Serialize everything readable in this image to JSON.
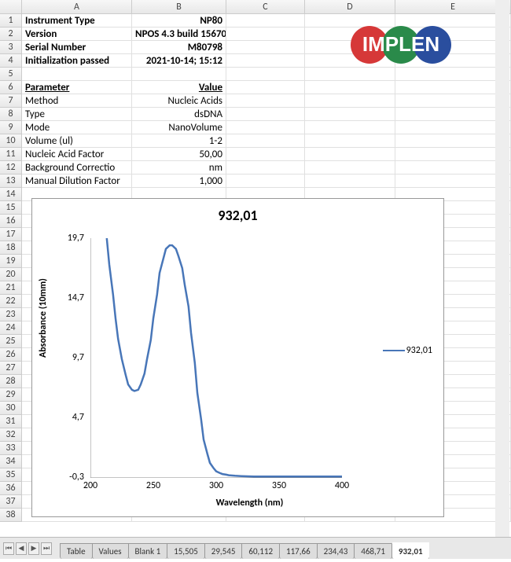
{
  "columns": [
    "A",
    "B",
    "C",
    "D",
    "E"
  ],
  "rows_count": 38,
  "cells": {
    "1": {
      "A": "Instrument Type",
      "B": "NP80",
      "bold": true
    },
    "2": {
      "A": "Version",
      "B": "NPOS 4.3 build 15670",
      "bold": true
    },
    "3": {
      "A": "Serial Number",
      "B": "M80798",
      "bold": true
    },
    "4": {
      "A": "Initialization passed",
      "B": "2021-10-14;  15:12",
      "bold": true
    },
    "5": {
      "A": "",
      "B": ""
    },
    "6": {
      "A": "Parameter",
      "B": "Value",
      "bold": true,
      "underline": true
    },
    "7": {
      "A": "Method",
      "B": "Nucleic Acids"
    },
    "8": {
      "A": "Type",
      "B": "dsDNA"
    },
    "9": {
      "A": "Mode",
      "B": "NanoVolume"
    },
    "10": {
      "A": "Volume (ul)",
      "B": "1-2"
    },
    "11": {
      "A": "Nucleic Acid Factor",
      "B": "50,00"
    },
    "12": {
      "A": "Background Correctio",
      "B": "nm"
    },
    "13": {
      "A": "Manual Dilution Factor",
      "B": "1,000"
    }
  },
  "logo": {
    "text": "IMPLEN",
    "colors": [
      "#d63838",
      "#2a8a4a",
      "#2a4e9e"
    ]
  },
  "chart_data": {
    "type": "line",
    "title": "932,01",
    "xlabel": "Wavelength (nm)",
    "ylabel": "Absorbance (10mm)",
    "xlim": [
      200,
      400
    ],
    "ylim": [
      -0.3,
      19.7
    ],
    "xticks": [
      200,
      250,
      300,
      350,
      400
    ],
    "yticks": [
      -0.3,
      4.7,
      9.7,
      14.7,
      19.7
    ],
    "series": [
      {
        "name": "932,01",
        "color": "#4876b8",
        "x": [
          213,
          215,
          218,
          220,
          222,
          225,
          228,
          230,
          233,
          235,
          238,
          240,
          243,
          245,
          248,
          250,
          253,
          255,
          258,
          260,
          263,
          265,
          268,
          270,
          273,
          275,
          278,
          280,
          283,
          285,
          288,
          290,
          293,
          295,
          298,
          300,
          303,
          305,
          308,
          310,
          315,
          320,
          330,
          340,
          350,
          360,
          370,
          380,
          390,
          400
        ],
        "y": [
          19.7,
          17.5,
          15.0,
          13.0,
          11.3,
          9.6,
          8.3,
          7.5,
          7.05,
          6.95,
          7.05,
          7.5,
          8.4,
          9.6,
          11.2,
          13.0,
          15.0,
          16.8,
          18.0,
          18.8,
          19.1,
          19.1,
          18.8,
          18.2,
          17.2,
          15.8,
          14.0,
          11.8,
          9.3,
          6.8,
          4.6,
          2.9,
          1.7,
          0.95,
          0.5,
          0.25,
          0.1,
          0.02,
          -0.03,
          -0.08,
          -0.12,
          -0.15,
          -0.18,
          -0.18,
          -0.18,
          -0.18,
          -0.18,
          -0.18,
          -0.18,
          -0.18
        ]
      }
    ]
  },
  "tabs": {
    "items": [
      "Table",
      "Values",
      "Blank 1",
      "15,505",
      "29,545",
      "60,112",
      "117,66",
      "234,43",
      "468,71",
      "932,01"
    ],
    "active": "932,01"
  }
}
